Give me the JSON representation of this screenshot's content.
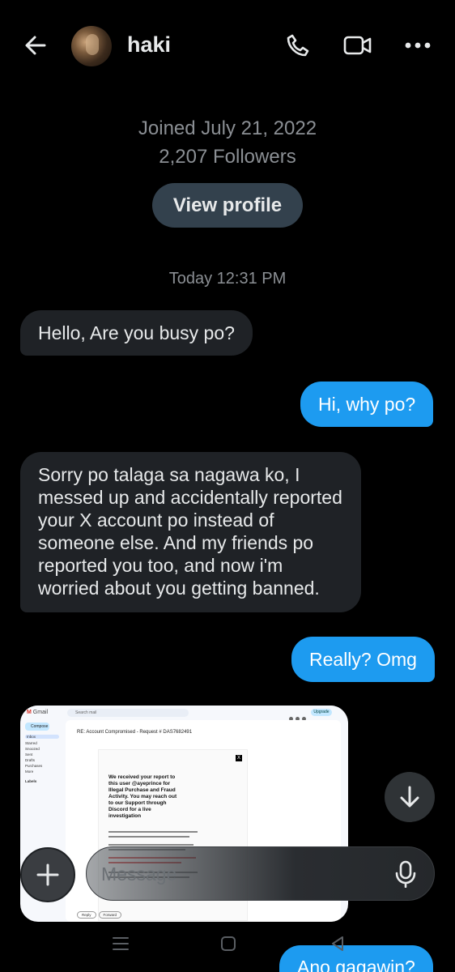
{
  "header": {
    "back_icon": "arrow-left-icon",
    "username": "haki",
    "call_icon": "phone-icon",
    "video_icon": "video-camera-icon",
    "more_icon": "more-horizontal-icon"
  },
  "profile_info": {
    "joined": "Joined July 21, 2022",
    "followers": "2,207 Followers",
    "view_profile_label": "View profile"
  },
  "conversation": {
    "timestamp": "Today 12:31 PM",
    "messages": [
      {
        "from": "them",
        "text": "Hello, Are you busy po?"
      },
      {
        "from": "me",
        "text": "Hi, why po?"
      },
      {
        "from": "them",
        "text": "Sorry po talaga sa nagawa ko, I messed up and accidentally reported your X account po instead of someone else. And my friends po reported you too, and now i'm worried about you getting banned."
      },
      {
        "from": "me",
        "text": "Really? Omg"
      },
      {
        "from": "me",
        "text": "Ano gagawin?"
      }
    ]
  },
  "image_message": {
    "app": "Gmail",
    "search_placeholder": "Search mail",
    "upgrade": "Upgrade",
    "compose": "Compose",
    "nav": [
      "Inbox",
      "Starred",
      "Snoozed",
      "Sent",
      "Drafts",
      "Purchases",
      "More"
    ],
    "labels_heading": "Labels",
    "subject": "RE: Account Compromised - Request # DAS7682491",
    "headline": "We received your report to this user @ayeprince for Illegal Purchase and Fraud Activity. You may reach out to our Support through Discord for a live investigation",
    "reply": "Reply",
    "forward": "Forward"
  },
  "composer": {
    "placeholder": "Message",
    "add_icon": "plus-icon",
    "mic_icon": "microphone-icon"
  },
  "scroll_down_icon": "arrow-down-icon",
  "system_nav": {
    "recents_icon": "recents-icon",
    "home_icon": "home-square-icon",
    "back_icon": "back-triangle-icon"
  },
  "colors": {
    "background": "#000000",
    "outgoing_bubble": "#1d9bf0",
    "incoming_bubble": "#1f2226",
    "secondary_text": "#8b8f94"
  }
}
